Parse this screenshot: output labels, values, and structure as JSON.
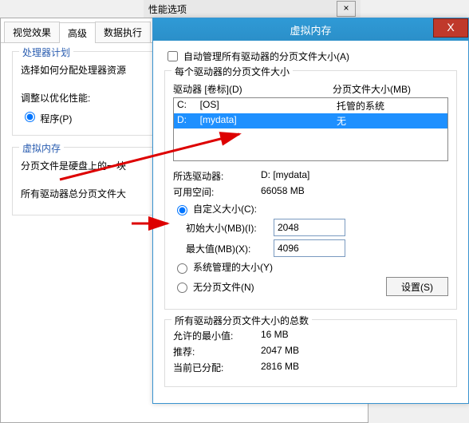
{
  "topstrip": {
    "label": "性能选项",
    "close": "×"
  },
  "back": {
    "tabs": [
      "视觉效果",
      "高级",
      "数据执行"
    ],
    "active_tab_index": 1,
    "processor": {
      "title": "处理器计划",
      "desc": "选择如何分配处理器资源",
      "adjust_label": "调整以优化性能:",
      "radio_programs": "程序(P)"
    },
    "vm": {
      "title": "虚拟内存",
      "desc1": "分页文件是硬盘上的一块",
      "desc2": "所有驱动器总分页文件大"
    }
  },
  "dialog": {
    "title": "虚拟内存",
    "close_x": "X",
    "auto_checkbox": "自动管理所有驱动器的分页文件大小(A)",
    "per_drive": {
      "title": "每个驱动器的分页文件大小",
      "col_drive": "驱动器 [卷标](D)",
      "col_size": "分页文件大小(MB)",
      "rows": [
        {
          "drive": "C:     [OS]",
          "size": "托管的系统",
          "selected": false
        },
        {
          "drive": "D:     [mydata]",
          "size": "无",
          "selected": true
        }
      ],
      "selected_drive_label": "所选驱动器:",
      "selected_drive_value": "D:  [mydata]",
      "free_space_label": "可用空间:",
      "free_space_value": "66058 MB",
      "opt_custom": "自定义大小(C):",
      "initial_label": "初始大小(MB)(I):",
      "initial_value": "2048",
      "max_label": "最大值(MB)(X):",
      "max_value": "4096",
      "opt_system": "系统管理的大小(Y)",
      "opt_none": "无分页文件(N)",
      "set_button": "设置(S)"
    },
    "totals": {
      "title": "所有驱动器分页文件大小的总数",
      "min_label": "允许的最小值:",
      "min_value": "16 MB",
      "rec_label": "推荐:",
      "rec_value": "2047 MB",
      "cur_label": "当前已分配:",
      "cur_value": "2816 MB"
    }
  }
}
